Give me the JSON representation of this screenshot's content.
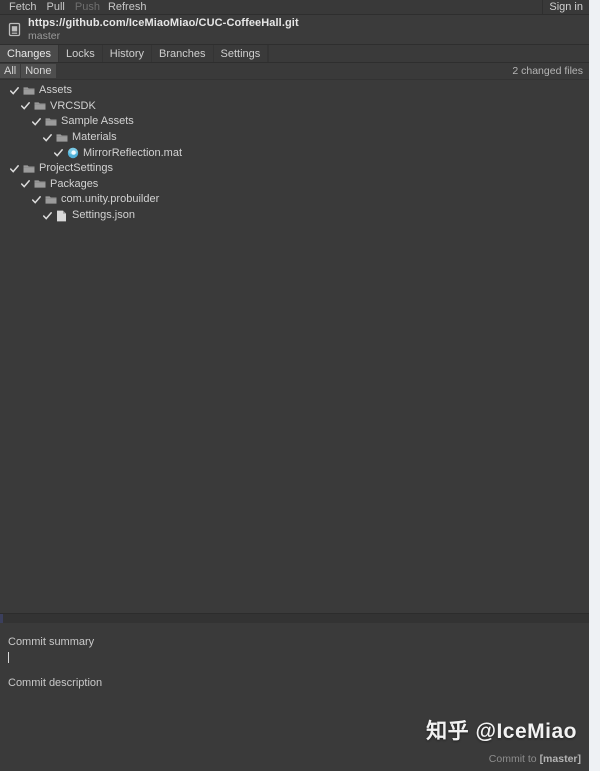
{
  "toolbar": {
    "buttons": [
      {
        "label": "Fetch",
        "state": "enabled"
      },
      {
        "label": "Pull",
        "state": "enabled"
      },
      {
        "label": "Push",
        "state": "disabled"
      },
      {
        "label": "Refresh",
        "state": "enabled"
      }
    ],
    "sign_in": "Sign in"
  },
  "repo": {
    "icon": "repository-icon",
    "url": "https://github.com/IceMiaoMiao/CUC-CoffeeHall.git",
    "branch": "master"
  },
  "tabs": [
    {
      "label": "Changes",
      "active": true
    },
    {
      "label": "Locks",
      "active": false
    },
    {
      "label": "History",
      "active": false
    },
    {
      "label": "Branches",
      "active": false
    },
    {
      "label": "Settings",
      "active": false
    }
  ],
  "selection_bar": {
    "all_label": "All",
    "none_label": "None",
    "changed_files": "2 changed files"
  },
  "tree": [
    {
      "label": "Assets",
      "depth": 0,
      "icon": "folder-icon",
      "checked": true
    },
    {
      "label": "VRCSDK",
      "depth": 1,
      "icon": "folder-icon",
      "checked": true
    },
    {
      "label": "Sample Assets",
      "depth": 2,
      "icon": "folder-icon",
      "checked": true
    },
    {
      "label": "Materials",
      "depth": 3,
      "icon": "folder-icon",
      "checked": true
    },
    {
      "label": "MirrorReflection.mat",
      "depth": 4,
      "icon": "material-icon",
      "checked": true
    },
    {
      "label": "ProjectSettings",
      "depth": 0,
      "icon": "folder-icon",
      "checked": true
    },
    {
      "label": "Packages",
      "depth": 1,
      "icon": "folder-icon",
      "checked": true
    },
    {
      "label": "com.unity.probuilder",
      "depth": 2,
      "icon": "folder-icon",
      "checked": true
    },
    {
      "label": "Settings.json",
      "depth": 3,
      "icon": "file-icon",
      "checked": true
    }
  ],
  "commit": {
    "summary_label": "Commit summary",
    "summary_value": "",
    "description_label": "Commit description",
    "description_value": "",
    "action_prefix": "Commit to ",
    "action_target": "[master]"
  },
  "watermark": {
    "text": "知乎 @IceMiao"
  },
  "colors": {
    "window_bg": "#3a3a3a",
    "header_bg": "#3b3b3b",
    "tab_active_bg": "#4b4b4b",
    "button_bg": "#4e4e4e",
    "text": "#d2d2d2",
    "muted_text": "#9a9a9a",
    "disabled_text": "#6f6f6f",
    "folder_icon": "#9b9b9b",
    "material_icon": "#4fb0d8",
    "accent": "#3b3f5c",
    "page_bg": "#eef1f4"
  }
}
